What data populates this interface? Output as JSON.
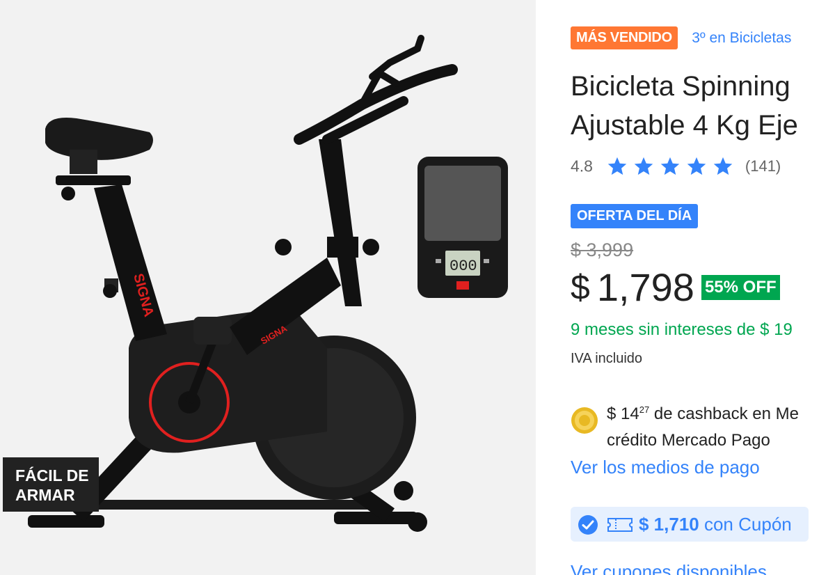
{
  "gallery": {
    "badge_line1": "FÁCIL DE",
    "badge_line2": "ARMAR",
    "frame_brand": "SIGNA",
    "console_display": "000"
  },
  "product": {
    "best_seller_badge": "MÁS VENDIDO",
    "ranking_link": "3º en Bicicletas",
    "title_line1": "Bicicleta Spinning",
    "title_line2": "Ajustable 4 Kg Eje",
    "rating": "4.8",
    "stars": 5,
    "reviews_count": "(141)",
    "deal_badge": "OFERTA DEL DÍA",
    "original_price": "$ 3,999",
    "currency_symbol": "$",
    "price": "1,798",
    "discount": "55% OFF",
    "installments": "9 meses sin intereses de $ 19",
    "tax_note": "IVA incluido",
    "cashback_amount": "$ 14",
    "cashback_cents": "27",
    "cashback_text": " de cashback en Me",
    "cashback_line2": "crédito Mercado Pago",
    "payment_methods_link": "Ver los medios de pago",
    "coupon_price": "$ 1,710",
    "coupon_suffix": " con Cupón",
    "coupons_link": "Ver cupones disponibles"
  },
  "colors": {
    "accent_blue": "#3483fa",
    "discount_green": "#00a650",
    "best_seller_orange": "#ff7733",
    "bike_red": "#e0201f"
  }
}
